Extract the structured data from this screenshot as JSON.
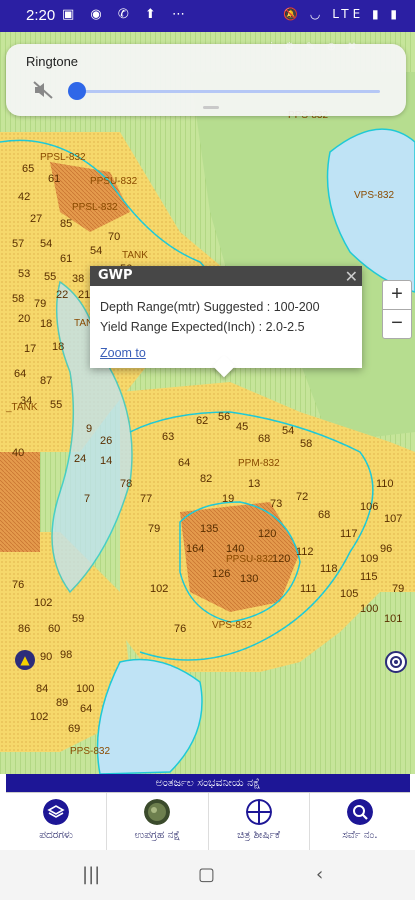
{
  "status_bar": {
    "time": "2:20",
    "left_icons": [
      "image-icon",
      "chat-icon",
      "whatsapp-icon",
      "navigation-icon",
      "more-icon"
    ],
    "right_icons": [
      "mute-icon",
      "wifi-icon",
      "volte-icon",
      "signal-icon",
      "battery-icon"
    ],
    "overflow": "⋯",
    "network": "LTE"
  },
  "volume_panel": {
    "title": "Ringtone",
    "level": 0
  },
  "map": {
    "labels": [
      "PPSL-832",
      "PPSU-832",
      "PPS-832",
      "VPS-832",
      "PPM-832",
      "TANK",
      "TAN",
      "_TANK",
      "PPSU-832",
      "VPS-832",
      "PPS-832"
    ],
    "numbers": [
      "65",
      "61",
      "42",
      "27",
      "85",
      "70",
      "61",
      "57",
      "54",
      "54",
      "53",
      "55",
      "38",
      "61",
      "56",
      "58",
      "79",
      "22",
      "21",
      "20",
      "18",
      "17",
      "18",
      "64",
      "87",
      "34",
      "55",
      "9",
      "26",
      "24",
      "14",
      "40",
      "7",
      "78",
      "77",
      "102",
      "76",
      "86",
      "60",
      "59",
      "98",
      "90",
      "102",
      "89",
      "84",
      "100",
      "69",
      "64",
      "62",
      "56",
      "45",
      "68",
      "54",
      "58",
      "63",
      "64",
      "82",
      "19",
      "13",
      "73",
      "72",
      "68",
      "79",
      "120",
      "112",
      "118",
      "117",
      "106",
      "96",
      "79",
      "109",
      "107",
      "110",
      "105",
      "115",
      "126",
      "130",
      "164",
      "135",
      "140",
      "111",
      "120",
      "100",
      "101",
      "102",
      "76"
    ]
  },
  "zoom_controls": {
    "plus": "+",
    "minus": "−"
  },
  "popup": {
    "title": "GWP",
    "close": "✕",
    "line1": "Depth Range(mtr) Suggested : 100-200",
    "line2": "Yield Range Expected(Inch) : 2.0-2.5",
    "zoom_link": "Zoom to"
  },
  "banner": "ಅಂತರ್ಜಲ ಸಂಭವನೀಯ ನಕ್ಷೆ",
  "bottom_nav": [
    {
      "label": "ಪದರಗಳು",
      "icon": "layers-icon"
    },
    {
      "label": "ಉಪಗ್ರಹ ನಕ್ಷೆ",
      "icon": "satellite-map-icon"
    },
    {
      "label": "ಚಿತ್ರ ಶೀರ್ಷಿಕೆ",
      "icon": "grid-icon"
    },
    {
      "label": "ಸರ್ವೆ ನಂ.",
      "icon": "search-icon"
    }
  ],
  "colors": {
    "status_bar": "#2b1fa3",
    "banner": "#1d1696",
    "map_green": "#b7db86",
    "map_yellow": "#f6d86b",
    "map_orange": "#e79446",
    "water": "#bfe3f5",
    "cyan_boundary": "#1fc9d6"
  }
}
